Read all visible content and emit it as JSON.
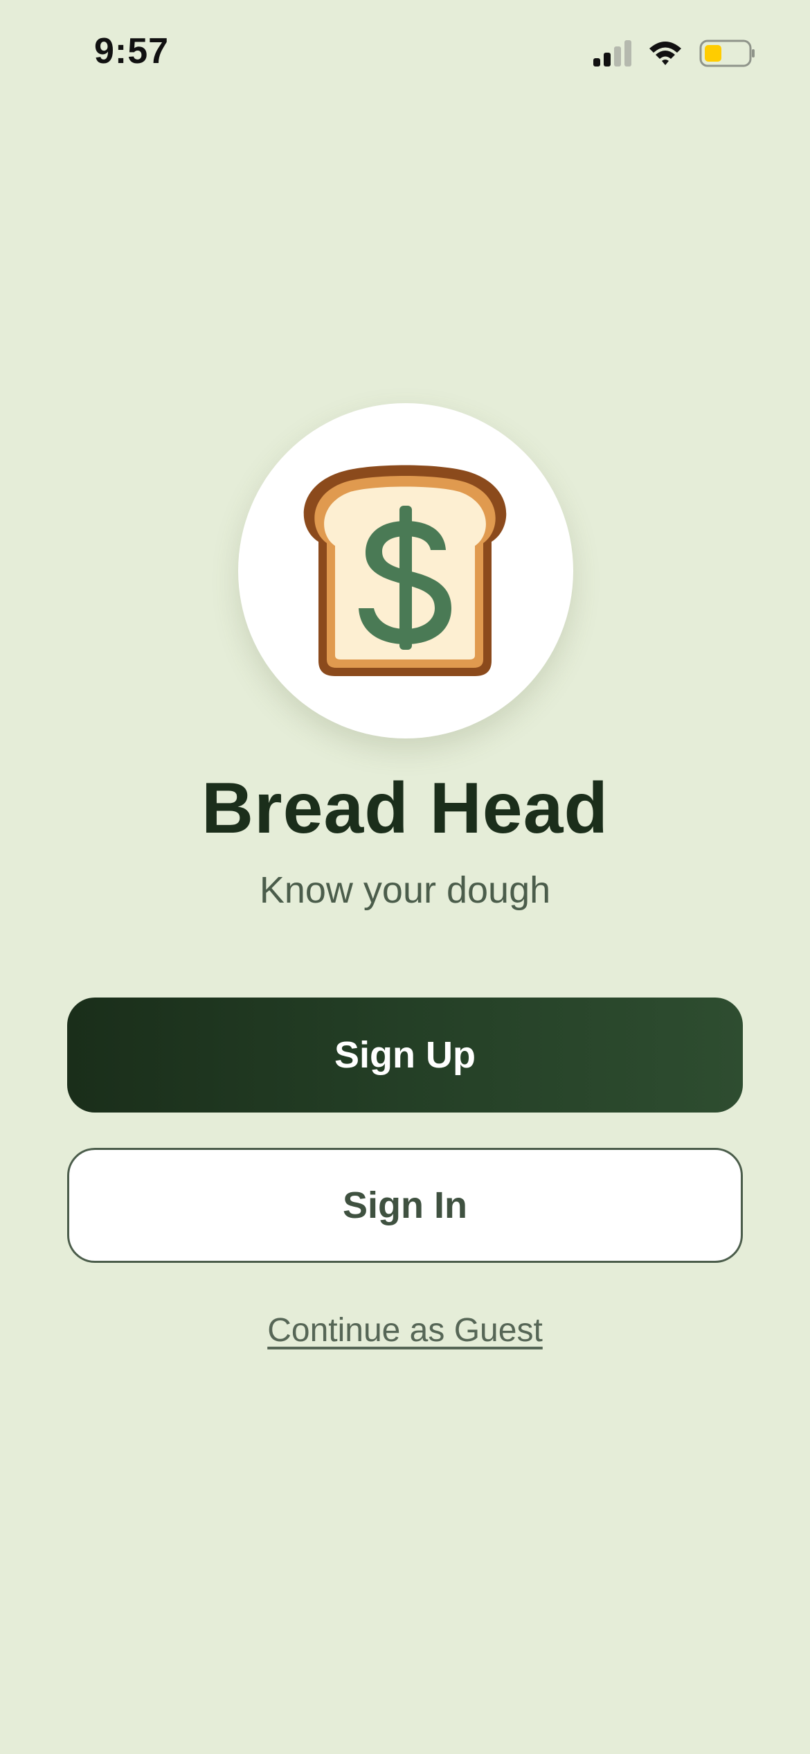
{
  "status_bar": {
    "time": "9:57"
  },
  "icons": {
    "signal": "cellular-signal-icon",
    "wifi": "wifi-icon",
    "battery": "battery-icon",
    "logo": "bread-dollar-icon"
  },
  "colors": {
    "background": "#e5edd8",
    "primary_dark": "#1b2e1b",
    "primary_end": "#2e4d30",
    "text_muted": "#4b5d4b",
    "dollar_green": "#4a7a55",
    "crust_brown": "#8b4a1c",
    "crust_orange": "#e09a4f",
    "bread_fill": "#fdefd2",
    "battery_yellow": "#ffcc00"
  },
  "app": {
    "title": "Bread Head",
    "tagline": "Know your dough"
  },
  "actions": {
    "sign_up_label": "Sign Up",
    "sign_in_label": "Sign In",
    "guest_label": "Continue as Guest"
  }
}
